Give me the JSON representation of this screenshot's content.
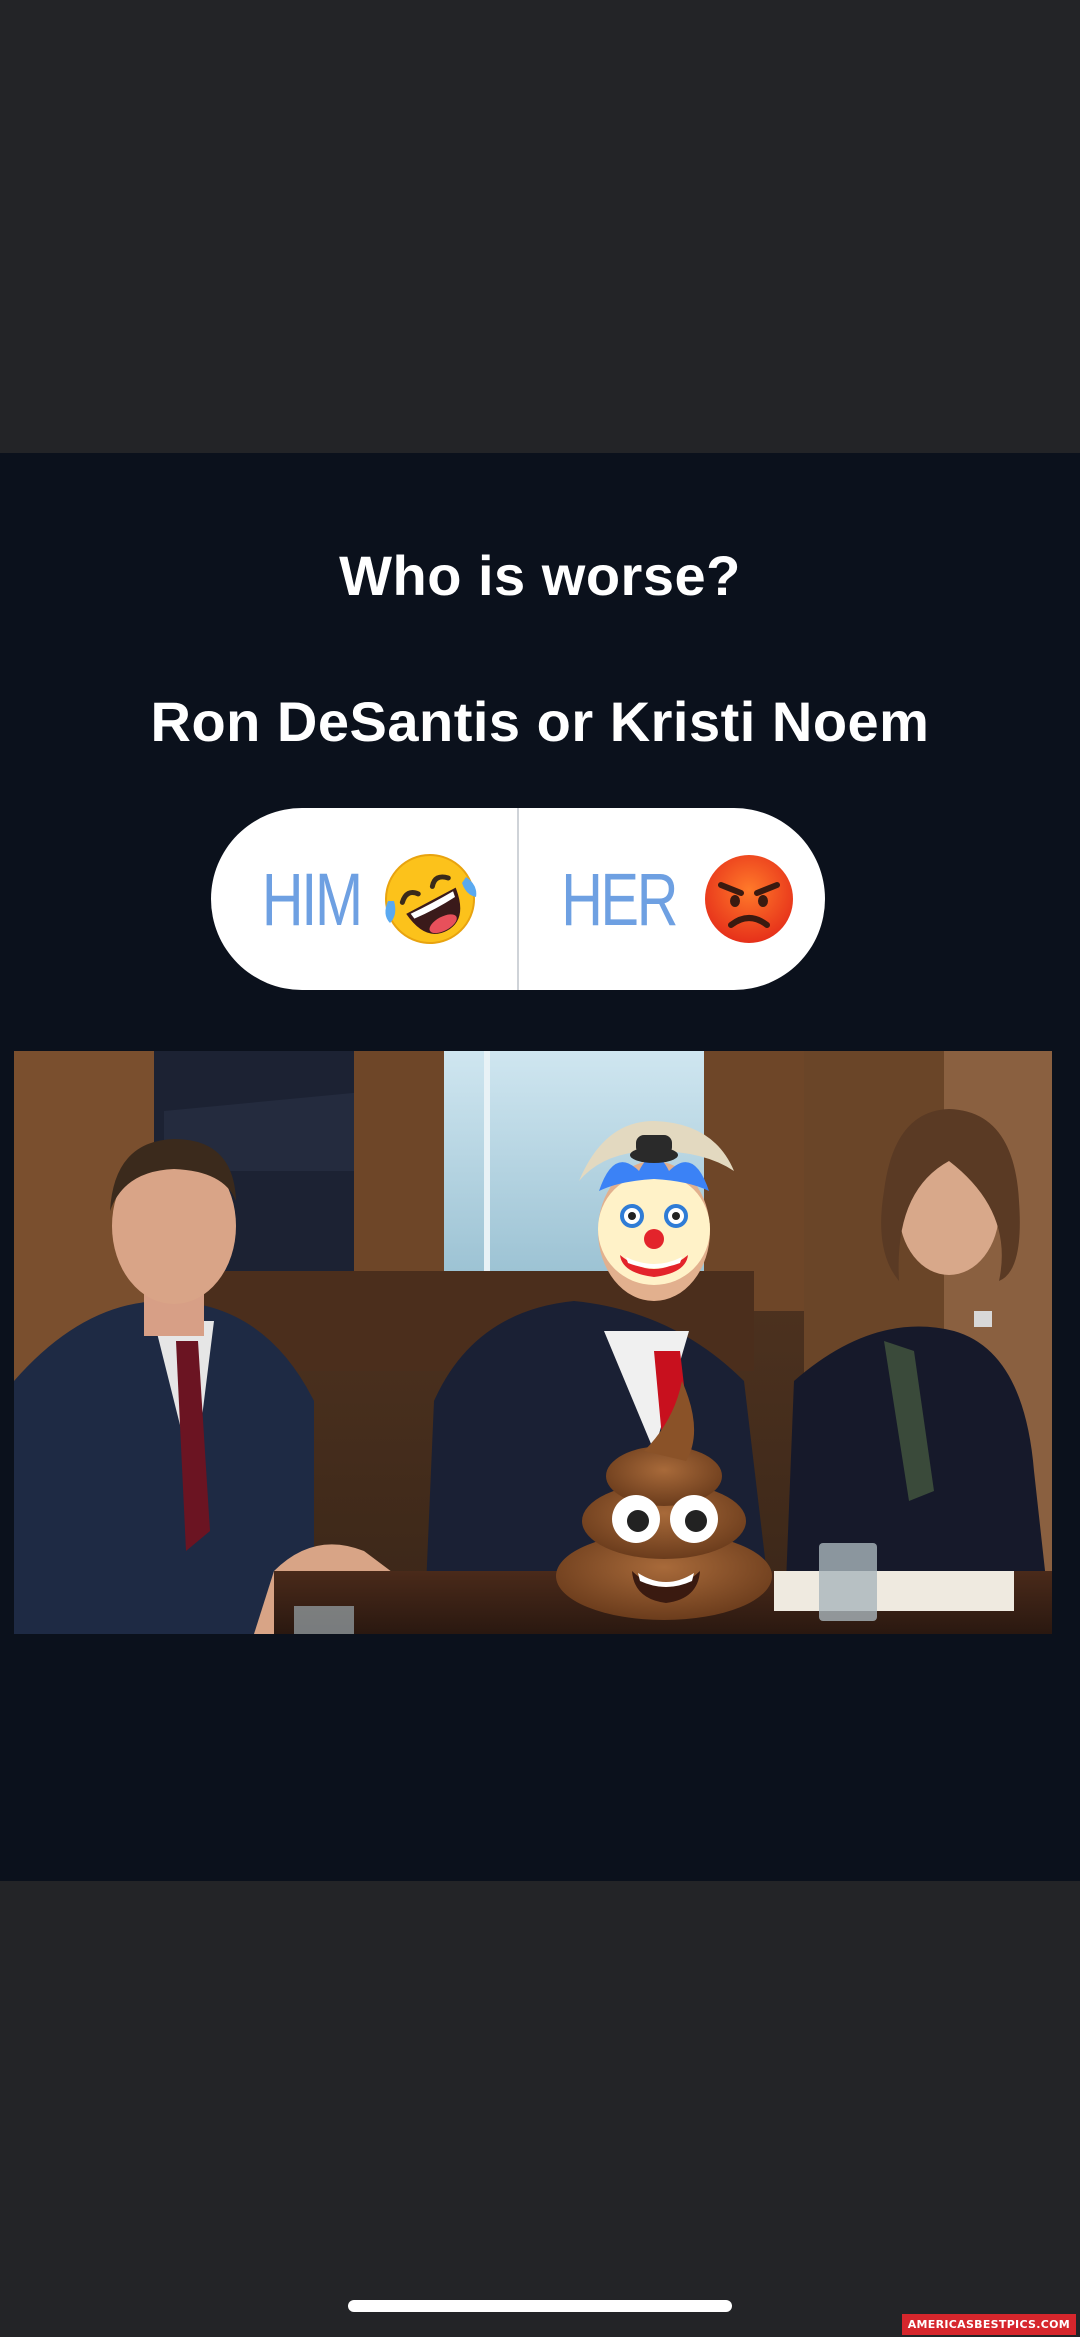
{
  "story": {
    "question_line1": "Who is worse?",
    "question_line2": "Ron DeSantis or Kristi Noem"
  },
  "poll": {
    "options": [
      {
        "label": "HIM",
        "emoji": "rolling-on-floor-laughing-icon"
      },
      {
        "label": "HER",
        "emoji": "angry-face-icon"
      }
    ]
  },
  "photo": {
    "stickers": [
      "clown-face-icon",
      "pile-of-poo-icon"
    ]
  },
  "watermark": "AMERICASBESTPICS.COM",
  "colors": {
    "background": "#232427",
    "card": "#0b111c",
    "poll_label": "#6ea0e2",
    "watermark": "#d6262c"
  }
}
